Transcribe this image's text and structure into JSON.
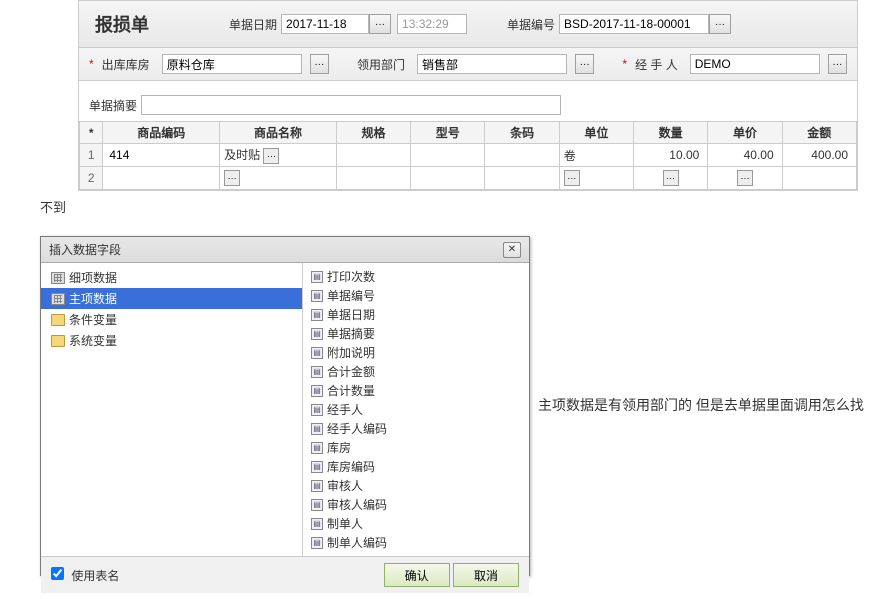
{
  "header": {
    "title": "报损单",
    "date_label": "单据日期",
    "date_value": "2017-11-18",
    "time_value": "13:32:29",
    "number_label": "单据编号",
    "number_value": "BSD-2017-11-18-00001"
  },
  "row2": {
    "warehouse_label": "出库库房",
    "warehouse_value": "原料仓库",
    "dept_label": "领用部门",
    "dept_value": "销售部",
    "handler_label": "经 手 人",
    "handler_value": "DEMO"
  },
  "summary_label": "单据摘要",
  "summary_value": "",
  "table": {
    "star": "*",
    "headers": [
      "商品编码",
      "商品名称",
      "规格",
      "型号",
      "条码",
      "单位",
      "数量",
      "单价",
      "金额"
    ],
    "rows": [
      {
        "n": "1",
        "code": "414",
        "name": "及时贴",
        "spec": "",
        "model": "",
        "barcode": "",
        "unit": "卷",
        "qty": "10.00",
        "price": "40.00",
        "amount": "400.00"
      },
      {
        "n": "2",
        "code": "",
        "name": "",
        "spec": "",
        "model": "",
        "barcode": "",
        "unit": "",
        "qty": "",
        "price": "",
        "amount": ""
      }
    ]
  },
  "dialog": {
    "title": "插入数据字段",
    "tree": [
      {
        "label": "细项数据",
        "icon": "grid",
        "selected": false
      },
      {
        "label": "主项数据",
        "icon": "grid",
        "selected": true
      },
      {
        "label": "条件变量",
        "icon": "folder",
        "selected": false
      },
      {
        "label": "系统变量",
        "icon": "folder",
        "selected": false
      }
    ],
    "list": [
      "打印次数",
      "单据编号",
      "单据日期",
      "单据摘要",
      "附加说明",
      "合计金额",
      "合计数量",
      "经手人",
      "经手人编码",
      "库房",
      "库房编码",
      "审核人",
      "审核人编码",
      "制单人",
      "制单人编码"
    ],
    "use_table_label": "使用表名",
    "use_table_checked": true,
    "ok": "确认",
    "cancel": "取消"
  },
  "annotation": "主项数据是有领用部门的  但是去单据里面调用怎么找",
  "below": "不到"
}
